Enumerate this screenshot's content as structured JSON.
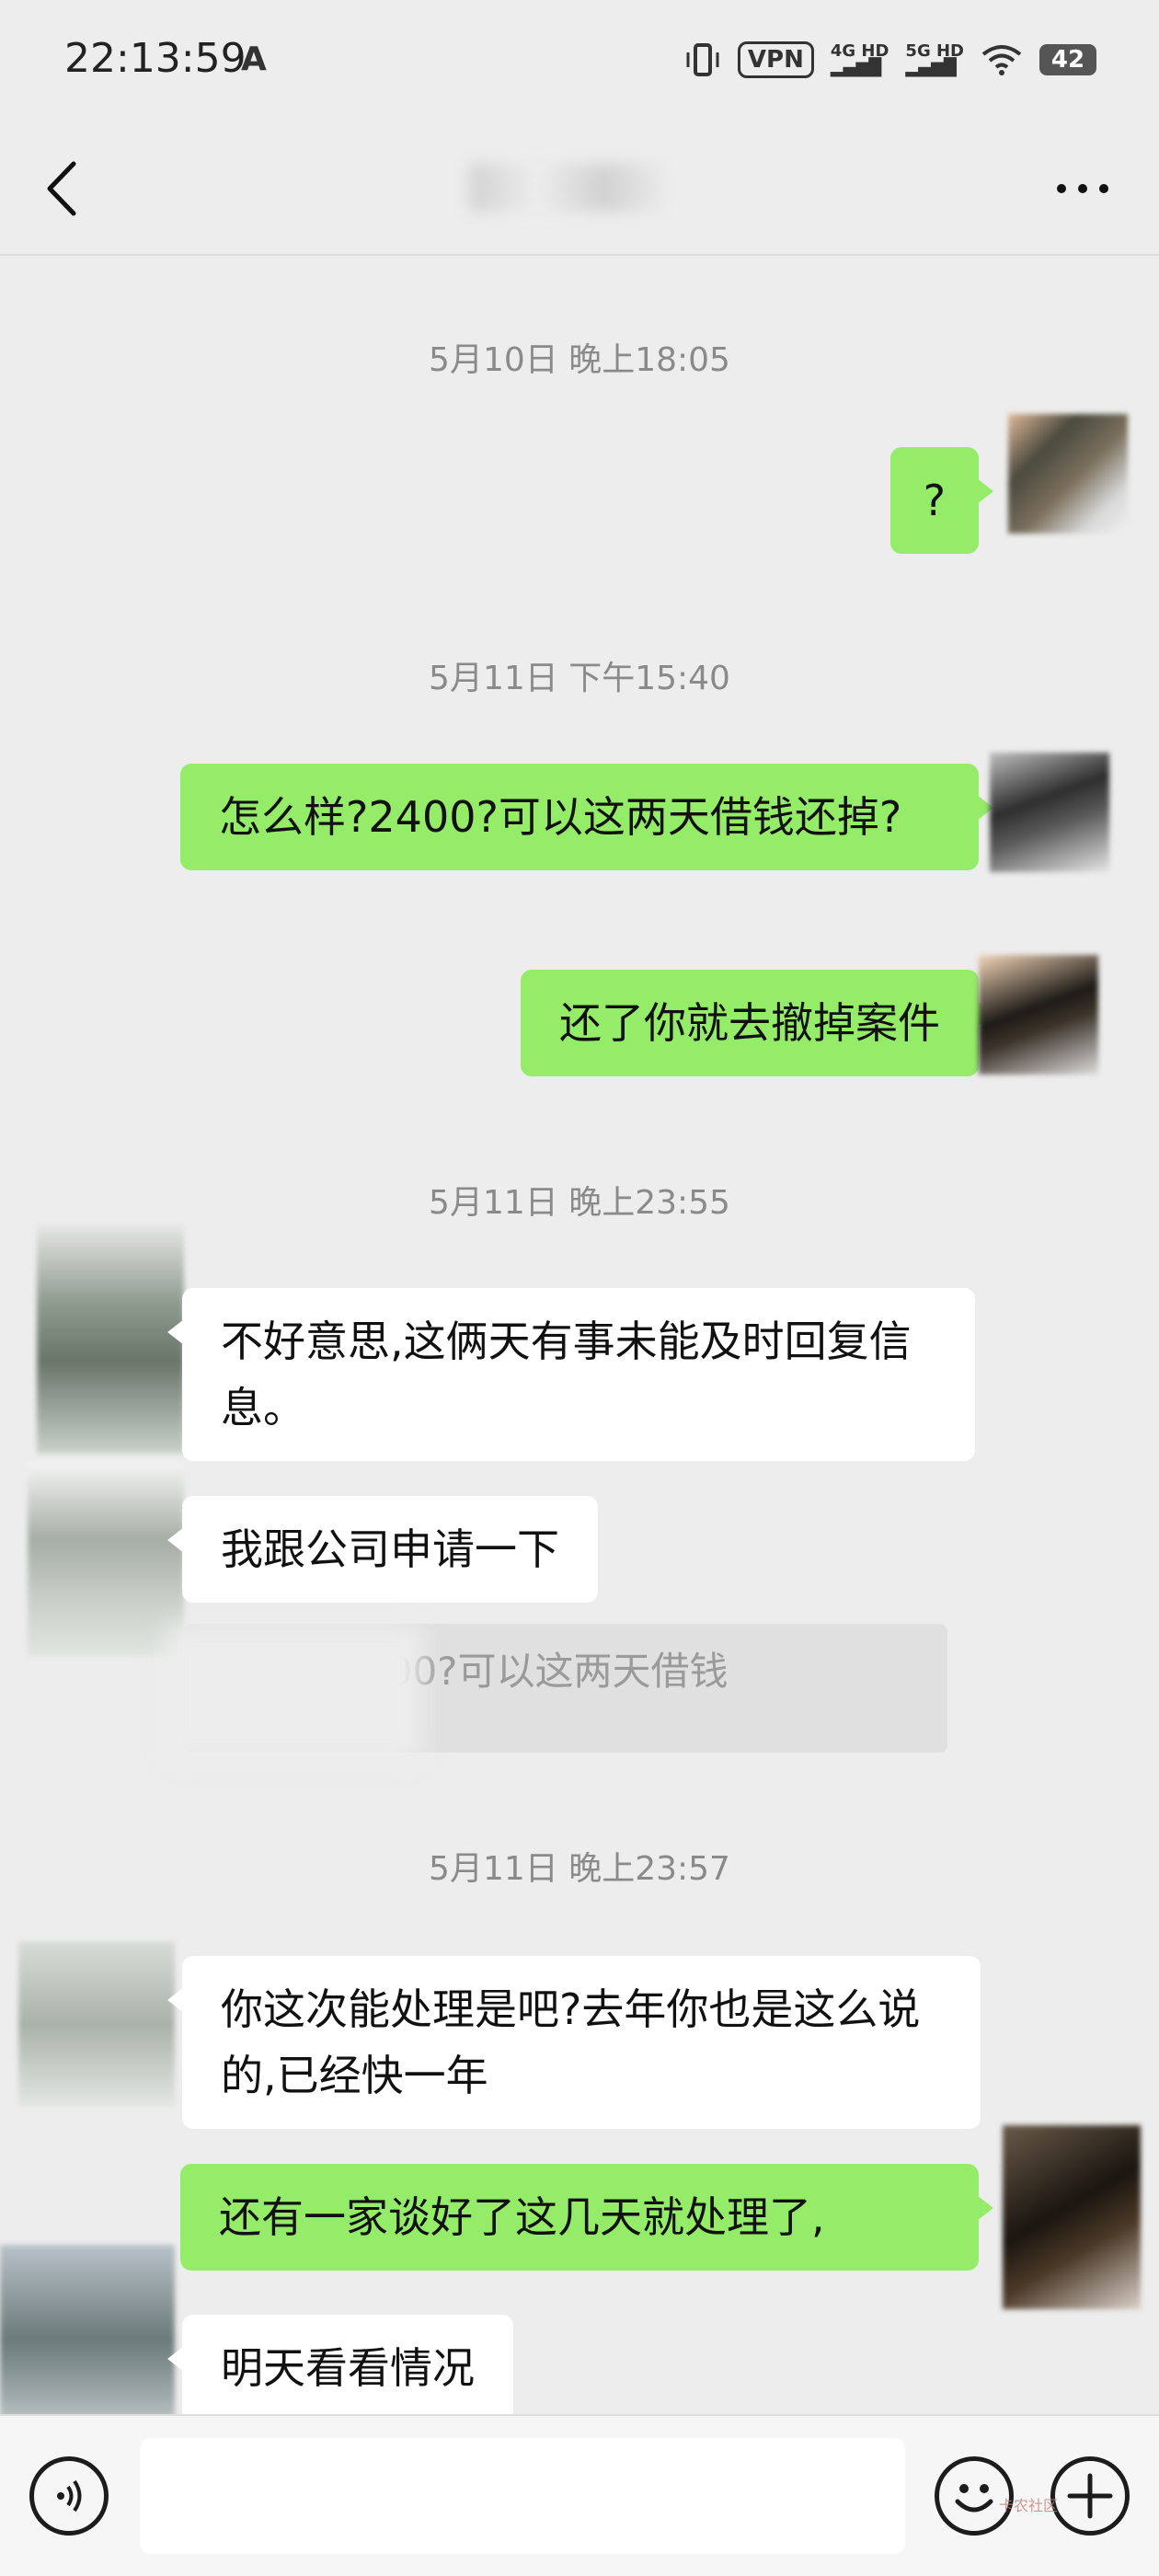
{
  "status_bar": {
    "time": "22:13:59",
    "alert_glyph": "A",
    "vpn": "VPN",
    "net1": "4G HD",
    "net2": "5G HD",
    "battery": "42"
  },
  "header": {
    "back_icon": "chevron-left-icon",
    "more_icon": "more-dots-icon"
  },
  "messages": [
    {
      "type": "timestamp",
      "text": "5月10日 晚上18:05"
    },
    {
      "type": "sent",
      "text": "?"
    },
    {
      "type": "timestamp",
      "text": "5月11日 下午15:40"
    },
    {
      "type": "sent",
      "text": "怎么样?2400?可以这两天借钱还掉?"
    },
    {
      "type": "sent",
      "text": "还了你就去撤掉案件"
    },
    {
      "type": "timestamp",
      "text": "5月11日 晚上23:55"
    },
    {
      "type": "received",
      "text": "不好意思,这俩天有事未能及时回复信息。"
    },
    {
      "type": "received",
      "text": "我跟公司申请一下"
    },
    {
      "type": "quote",
      "text": "怎么样?2400?可以这两天借钱"
    },
    {
      "type": "timestamp",
      "text": "5月11日 晚上23:57"
    },
    {
      "type": "received",
      "text": "你这次能处理是吧?去年你也是这么说的,已经快一年"
    },
    {
      "type": "sent",
      "text": "还有一家谈好了这几天就处理了,"
    },
    {
      "type": "received",
      "text": "明天看看情况"
    }
  ],
  "input": {
    "value": "",
    "voice_icon": "voice-icon",
    "emoji_icon": "emoji-icon",
    "plus_icon": "plus-icon"
  },
  "watermark": "卡农社区",
  "colors": {
    "background": "#ededed",
    "sent_bubble": "#95ec69",
    "received_bubble": "#ffffff",
    "timestamp_text": "#8a8a8a"
  }
}
